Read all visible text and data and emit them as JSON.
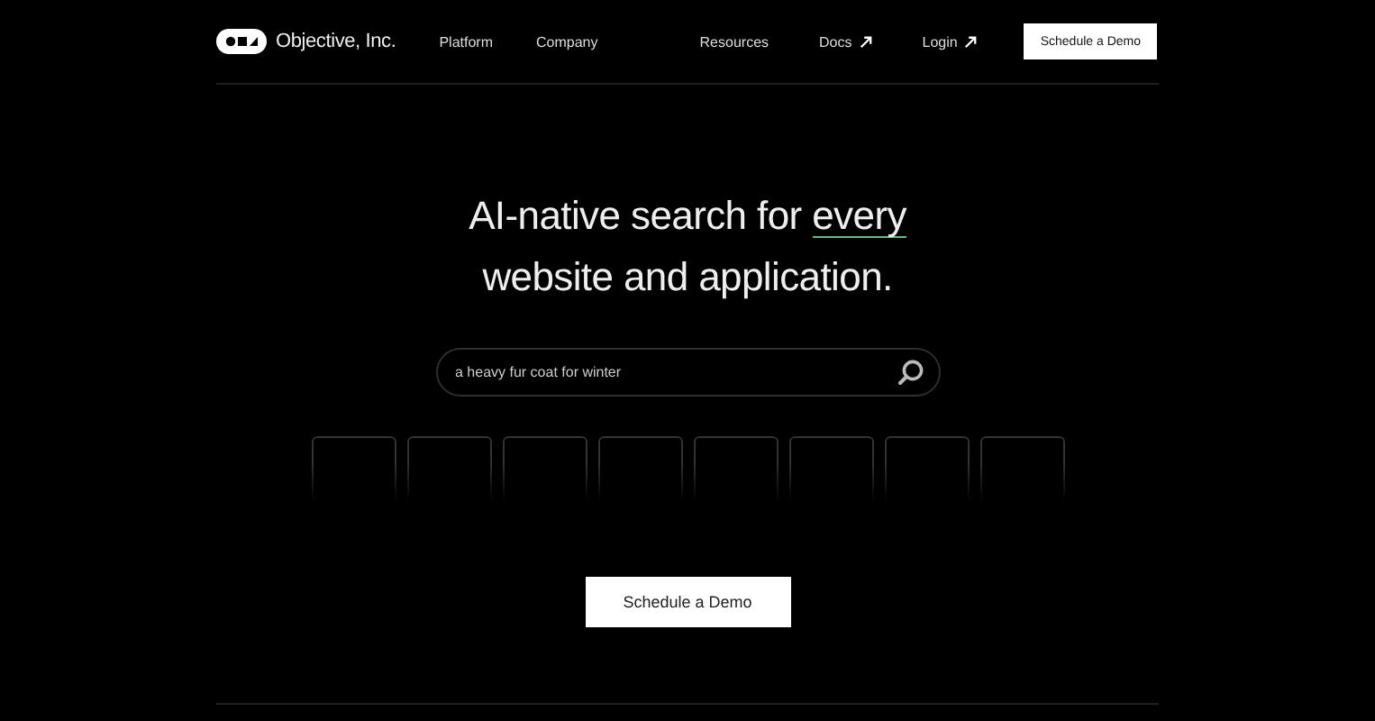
{
  "header": {
    "brand": "Objective, Inc.",
    "left_nav": [
      {
        "label": "Platform",
        "external": false
      },
      {
        "label": "Company",
        "external": false
      }
    ],
    "right_nav": [
      {
        "label": "Resources",
        "external": false
      },
      {
        "label": "Docs",
        "external": true
      },
      {
        "label": "Login",
        "external": true
      }
    ],
    "cta": "Schedule a Demo"
  },
  "hero": {
    "headline_before": "AI-native search for ",
    "headline_highlight": "every",
    "headline_after": " website and application.",
    "search": {
      "value": "a heavy fur coat for winter"
    },
    "result_tiles": [
      {
        "kind": "placeholder"
      },
      {
        "kind": "placeholder"
      },
      {
        "kind": "placeholder"
      },
      {
        "kind": "placeholder"
      },
      {
        "kind": "placeholder"
      },
      {
        "kind": "placeholder"
      },
      {
        "kind": "placeholder"
      },
      {
        "kind": "placeholder"
      }
    ],
    "cta": "Schedule a Demo"
  }
}
